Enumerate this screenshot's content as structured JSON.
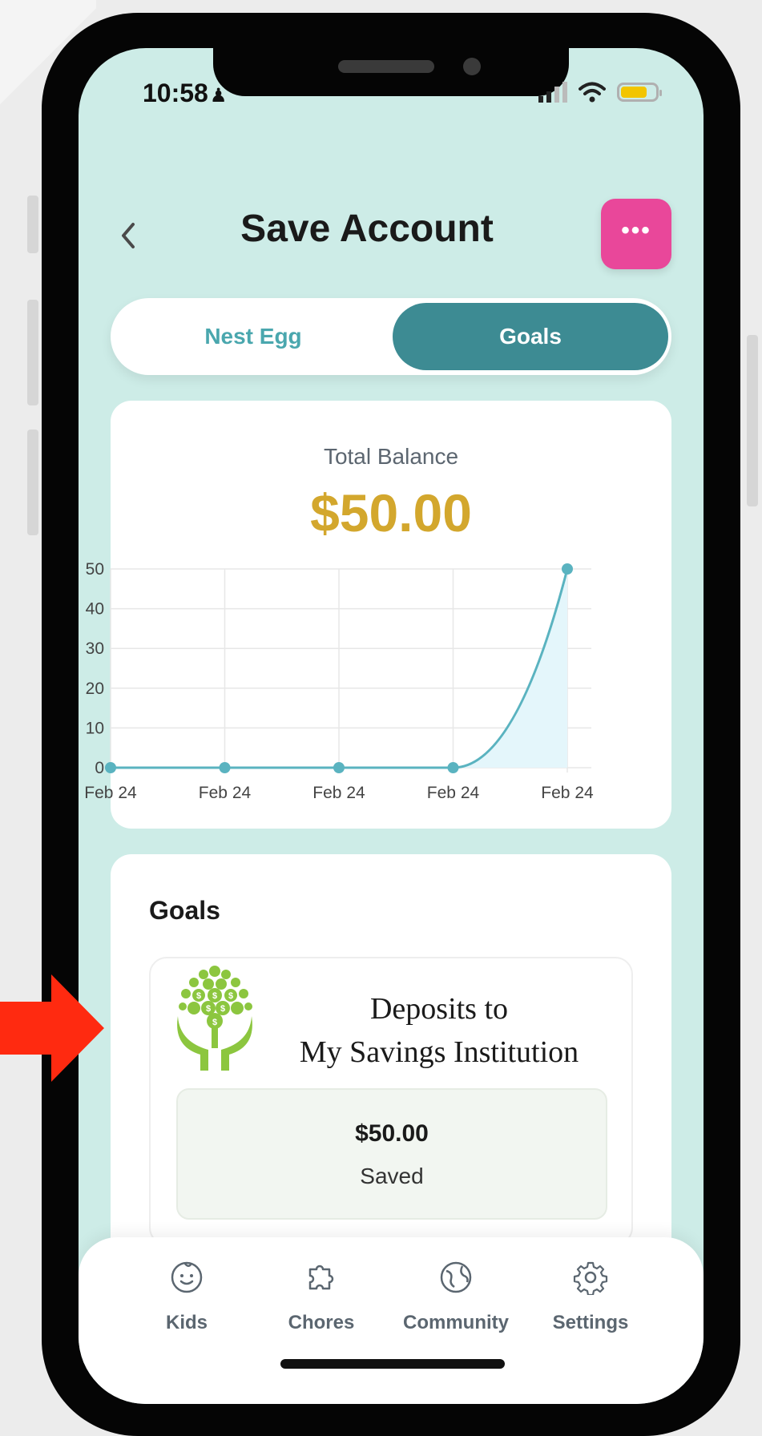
{
  "status_bar": {
    "time": "10:58"
  },
  "header": {
    "title": "Save Account",
    "back_icon": "chevron-left-icon",
    "menu_label": "•••"
  },
  "toggle": {
    "tabs": [
      {
        "label": "Nest Egg",
        "active": false
      },
      {
        "label": "Goals",
        "active": true
      }
    ]
  },
  "balance": {
    "label": "Total Balance",
    "value": "$50.00"
  },
  "chart_data": {
    "type": "area",
    "x": [
      "Feb 24",
      "Feb 24",
      "Feb 24",
      "Feb 24",
      "Feb 24"
    ],
    "y": [
      0,
      0,
      0,
      0,
      50
    ],
    "yticks": [
      0,
      10,
      20,
      30,
      40,
      50
    ],
    "ylim": [
      0,
      50
    ],
    "grid": true,
    "colors": {
      "line": "#5ab3c0",
      "fill": "#e4f6fb"
    }
  },
  "goals": {
    "title": "Goals",
    "items": [
      {
        "name_line1": "Deposits to",
        "name_line2": "My Savings Institution",
        "amount": "$50.00",
        "status": "Saved",
        "logo_icon": "money-tree-hands-icon"
      }
    ]
  },
  "nav": {
    "items": [
      {
        "label": "Kids",
        "icon": "baby-face-icon"
      },
      {
        "label": "Chores",
        "icon": "puzzle-icon"
      },
      {
        "label": "Community",
        "icon": "globe-icon"
      },
      {
        "label": "Settings",
        "icon": "gear-icon"
      }
    ]
  },
  "colors": {
    "accent": "#3d8b93",
    "menu_button": "#e9479a",
    "balance": "#d3a72d",
    "screen_bg": "#cdece7",
    "arrow": "#ff2a10"
  }
}
